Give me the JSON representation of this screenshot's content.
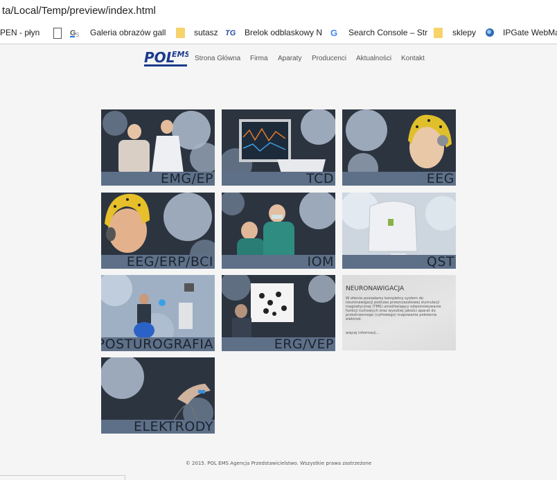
{
  "browser": {
    "url": "ta/Local/Temp/preview/index.html",
    "bookmarks": [
      {
        "label": "PEN - płyn",
        "icon": "none"
      },
      {
        "label": "",
        "icon": "page-icon"
      },
      {
        "label": "Galeria obrazów gall",
        "icon": "gs-icon"
      },
      {
        "label": "sutasz",
        "icon": "folder-icon"
      },
      {
        "label": "Brelok odblaskowy N",
        "icon": "tg-icon"
      },
      {
        "label": "Search Console – Str",
        "icon": "google-icon"
      },
      {
        "label": "sklepy",
        "icon": "folder-icon"
      },
      {
        "label": "IPGate WebMa",
        "icon": "ipgate-icon"
      }
    ]
  },
  "site": {
    "logo_text": "POL",
    "logo_sub": "EMS",
    "nav": [
      "Strona Główna",
      "Firma",
      "Aparaty",
      "Producenci",
      "Aktualności",
      "Kontakt"
    ]
  },
  "tiles": [
    {
      "label": "EMG/EP",
      "scene": "doctor-patient"
    },
    {
      "label": "TCD",
      "scene": "monitor-device"
    },
    {
      "label": "EEG",
      "scene": "girl-eeg-cap"
    },
    {
      "label": "EEG/ERP/BCI",
      "scene": "woman-eeg-cap"
    },
    {
      "label": "IOM",
      "scene": "surgeons"
    },
    {
      "label": "QST",
      "scene": "qst-device"
    },
    {
      "label": "POSTUROGRAFIA",
      "scene": "balance-ball"
    },
    {
      "label": "ERG/VEP",
      "scene": "vision-screen"
    },
    {
      "label": "ELEKTRODY",
      "scene": "hand-electrodes"
    }
  ],
  "neuro": {
    "title": "NEURONAWIGACJA",
    "text": "W ofercie posiadamy kompletny system do neuronawigacji podczas przezczaszkowej stymulacji magnetycznej (TMS) umożliwiający odwzorowywanie funkcji ruchowych oraz wysokiej jakości aparat do przestrzennego (cyfrowego) mapowania położenia elektrod.",
    "more": "więcej informacji..."
  },
  "footer": "© 2015. POL EMS Agencja Przedstawicielstwo. Wszystkie prawa zastrzeżone",
  "colors": {
    "label_band": "#5e7088",
    "label_text": "#1c2330",
    "logo_blue": "#1a3a8c"
  }
}
